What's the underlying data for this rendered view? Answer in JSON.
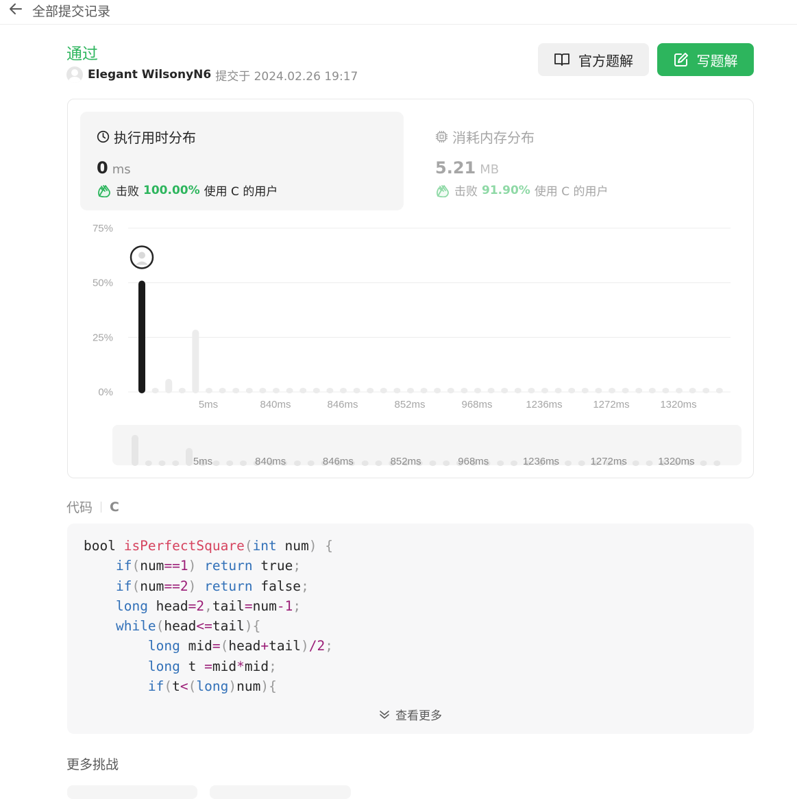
{
  "header": {
    "back_label": "全部提交记录"
  },
  "submission": {
    "status": "通过",
    "author": "Elegant WilsonyN6",
    "submitted_label": "提交于 2024.02.26 19:17"
  },
  "actions": {
    "official_solution": "官方题解",
    "write_solution": "写题解"
  },
  "runtime": {
    "title": "执行用时分布",
    "value": "0",
    "unit": "ms",
    "beats_prefix": "击败",
    "beats_pct": "100.00%",
    "beats_suffix": "使用 C 的用户"
  },
  "memory": {
    "title": "消耗内存分布",
    "value": "5.21",
    "unit": "MB",
    "beats_prefix": "击败",
    "beats_pct": "91.90%",
    "beats_suffix": "使用 C 的用户"
  },
  "chart_data": {
    "type": "bar",
    "title": "",
    "xlabel": "",
    "ylabel": "",
    "ylim": [
      0,
      75
    ],
    "y_ticks": [
      "75%",
      "50%",
      "25%",
      "0%"
    ],
    "x_tick_labels": [
      "5ms",
      "840ms",
      "846ms",
      "852ms",
      "968ms",
      "1236ms",
      "1272ms",
      "1320ms"
    ],
    "highlight_index": 0,
    "values": [
      51,
      1,
      6,
      1,
      28.5,
      1,
      1,
      1,
      1,
      1,
      1,
      1,
      1,
      1,
      1,
      1,
      1,
      1,
      1,
      1,
      1,
      1,
      1,
      1,
      1,
      1,
      1,
      1,
      1,
      1,
      1,
      1,
      1,
      1,
      1,
      1,
      1,
      1,
      1,
      1,
      1,
      1,
      1,
      1
    ],
    "grid": true,
    "overview_tick_labels": [
      "5ms",
      "840ms",
      "846ms",
      "852ms",
      "968ms",
      "1236ms",
      "1272ms",
      "1320ms"
    ]
  },
  "code_section": {
    "label": "代码",
    "language": "C",
    "show_more": "查看更多",
    "lines": [
      [
        [
          "pl",
          "bool "
        ],
        [
          "fn",
          "isPerfectSquare"
        ],
        [
          "punc",
          "("
        ],
        [
          "kw",
          "int"
        ],
        [
          "pl",
          " num"
        ],
        [
          "punc",
          ") {"
        ]
      ],
      [
        [
          "pl",
          "    "
        ],
        [
          "kw",
          "if"
        ],
        [
          "punc",
          "("
        ],
        [
          "pl",
          "num"
        ],
        [
          "op",
          "=="
        ],
        [
          "num",
          "1"
        ],
        [
          "punc",
          ") "
        ],
        [
          "kw",
          "return"
        ],
        [
          "pl",
          " true"
        ],
        [
          "punc",
          ";"
        ]
      ],
      [
        [
          "pl",
          "    "
        ],
        [
          "kw",
          "if"
        ],
        [
          "punc",
          "("
        ],
        [
          "pl",
          "num"
        ],
        [
          "op",
          "=="
        ],
        [
          "num",
          "2"
        ],
        [
          "punc",
          ") "
        ],
        [
          "kw",
          "return"
        ],
        [
          "pl",
          " false"
        ],
        [
          "punc",
          ";"
        ]
      ],
      [
        [
          "pl",
          "    "
        ],
        [
          "kw",
          "long"
        ],
        [
          "pl",
          " head"
        ],
        [
          "op",
          "="
        ],
        [
          "num",
          "2"
        ],
        [
          "punc",
          ","
        ],
        [
          "pl",
          "tail"
        ],
        [
          "op",
          "="
        ],
        [
          "pl",
          "num"
        ],
        [
          "op",
          "-"
        ],
        [
          "num",
          "1"
        ],
        [
          "punc",
          ";"
        ]
      ],
      [
        [
          "pl",
          "    "
        ],
        [
          "kw",
          "while"
        ],
        [
          "punc",
          "("
        ],
        [
          "pl",
          "head"
        ],
        [
          "op",
          "<="
        ],
        [
          "pl",
          "tail"
        ],
        [
          "punc",
          "){"
        ]
      ],
      [
        [
          "pl",
          "        "
        ],
        [
          "kw",
          "long"
        ],
        [
          "pl",
          " mid"
        ],
        [
          "op",
          "="
        ],
        [
          "punc",
          "("
        ],
        [
          "pl",
          "head"
        ],
        [
          "op",
          "+"
        ],
        [
          "pl",
          "tail"
        ],
        [
          "punc",
          ")"
        ],
        [
          "op",
          "/"
        ],
        [
          "num",
          "2"
        ],
        [
          "punc",
          ";"
        ]
      ],
      [
        [
          "pl",
          "        "
        ],
        [
          "kw",
          "long"
        ],
        [
          "pl",
          " t "
        ],
        [
          "op",
          "="
        ],
        [
          "pl",
          "mid"
        ],
        [
          "op",
          "*"
        ],
        [
          "pl",
          "mid"
        ],
        [
          "punc",
          ";"
        ]
      ],
      [
        [
          "pl",
          "        "
        ],
        [
          "kw",
          "if"
        ],
        [
          "punc",
          "("
        ],
        [
          "pl",
          "t"
        ],
        [
          "op",
          "<"
        ],
        [
          "punc",
          "("
        ],
        [
          "kw",
          "long"
        ],
        [
          "punc",
          ")"
        ],
        [
          "pl",
          "num"
        ],
        [
          "punc",
          "){"
        ]
      ]
    ]
  },
  "more_challenges": {
    "title": "更多挑战"
  },
  "colors": {
    "accent": "#2db55d",
    "bar_highlight": "#1a1a1a",
    "bar_muted": "#ececec"
  }
}
